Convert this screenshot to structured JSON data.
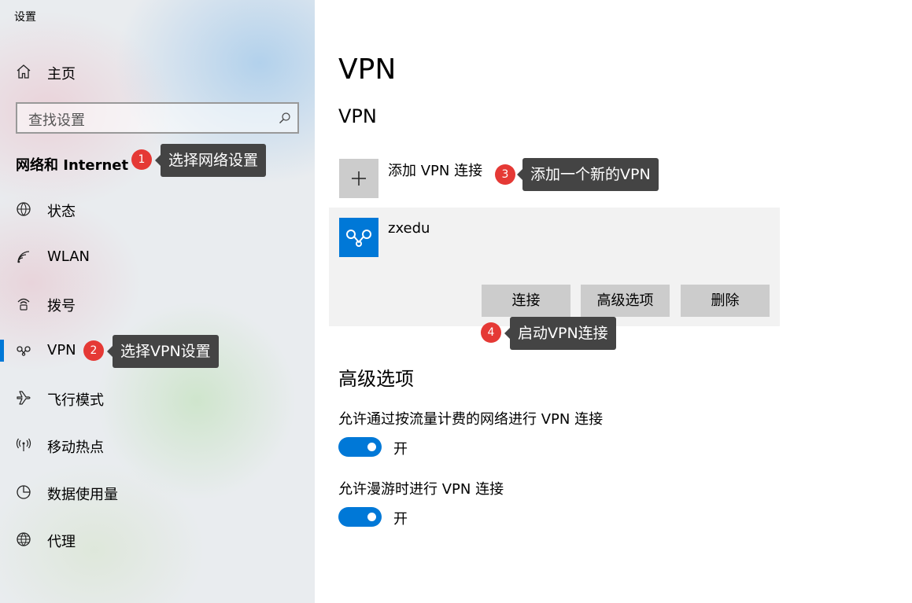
{
  "window": {
    "title": "设置"
  },
  "sidebar": {
    "home_label": "主页",
    "search_placeholder": "查找设置",
    "section_title": "网络和 Internet",
    "items": [
      {
        "label": "状态",
        "icon": "globe-status-icon"
      },
      {
        "label": "WLAN",
        "icon": "wifi-icon"
      },
      {
        "label": "拨号",
        "icon": "dialup-icon"
      },
      {
        "label": "VPN",
        "icon": "vpn-icon",
        "selected": true
      },
      {
        "label": "飞行模式",
        "icon": "airplane-icon"
      },
      {
        "label": "移动热点",
        "icon": "hotspot-icon"
      },
      {
        "label": "数据使用量",
        "icon": "data-usage-icon"
      },
      {
        "label": "代理",
        "icon": "proxy-globe-icon"
      }
    ]
  },
  "main": {
    "page_title": "VPN",
    "section_title": "VPN",
    "add_label": "添加 VPN 连接",
    "connection": {
      "name": "zxedu",
      "buttons": {
        "connect": "连接",
        "advanced": "高级选项",
        "delete": "删除"
      }
    },
    "advanced": {
      "title": "高级选项",
      "options": [
        {
          "label": "允许通过按流量计费的网络进行 VPN 连接",
          "state": "开",
          "on": true
        },
        {
          "label": "允许漫游时进行 VPN 连接",
          "state": "开",
          "on": true
        }
      ]
    }
  },
  "annotations": [
    {
      "number": "1",
      "text": "选择网络设置"
    },
    {
      "number": "2",
      "text": "选择VPN设置"
    },
    {
      "number": "3",
      "text": "添加一个新的VPN"
    },
    {
      "number": "4",
      "text": "启动VPN连接"
    }
  ],
  "colors": {
    "accent": "#0078d7",
    "badge": "#e53935",
    "tooltip": "#444444"
  }
}
